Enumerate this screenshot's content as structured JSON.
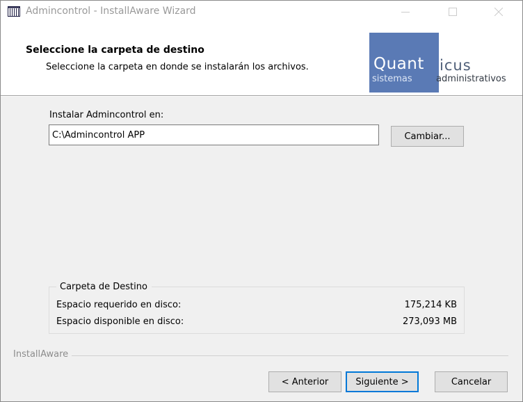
{
  "window": {
    "title": "Admincontrol - InstallAware Wizard",
    "icon": "installer-icon",
    "controls": {
      "minimize": "minimize-icon",
      "maximize": "maximize-icon",
      "close": "close-icon"
    }
  },
  "header": {
    "title": "Seleccione la carpeta de destino",
    "subtitle": "Seleccione la carpeta en donde se instalarán los archivos."
  },
  "logo": {
    "brand_part1": "Quant",
    "brand_part2": "icus",
    "tagline_part1": "sistemas",
    "tagline_part2": "administrativos",
    "colors": {
      "block": "#5a7ab5",
      "brand_dark": "#4f5f78"
    }
  },
  "install": {
    "label": "Instalar Admincontrol en:",
    "path_value": "C:\\Admincontrol APP",
    "change_button": "Cambiar..."
  },
  "destination": {
    "group_title": "Carpeta de Destino",
    "required_label": "Espacio requerido en disco:",
    "required_value": "175,214 KB",
    "available_label": "Espacio disponible en disco:",
    "available_value": "273,093 MB"
  },
  "footer": {
    "brand_label": "InstallAware",
    "back_button": "< Anterior",
    "next_button": "Siguiente >",
    "cancel_button": "Cancelar",
    "focus_color": "#0078d7"
  }
}
